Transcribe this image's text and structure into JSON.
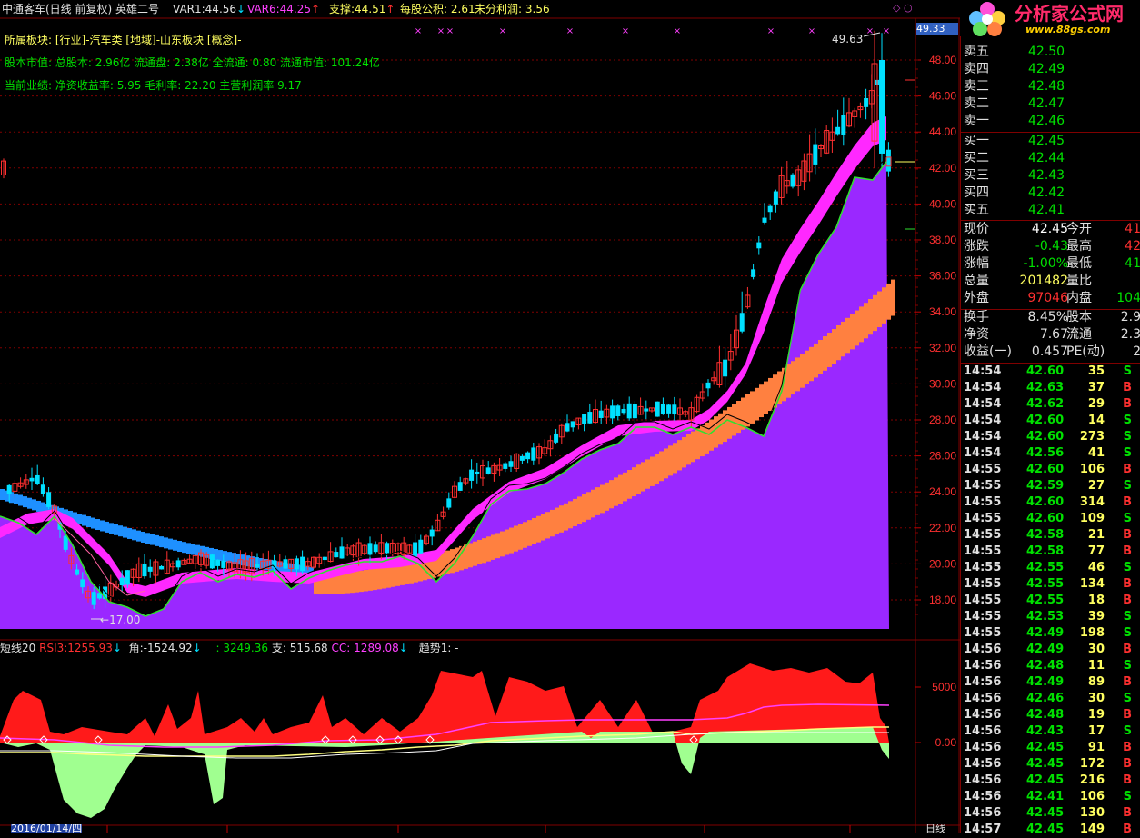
{
  "header": {
    "title": "中通客车(日线 前复权) 英雄二号",
    "var1_label": "VAR1:",
    "var1_value": "44.56",
    "var1_arrow": "↓",
    "var6_label": "VAR6:",
    "var6_value": "44.25",
    "var6_arrow": "↑",
    "support_label": "支撑:",
    "support_value": "44.51",
    "support_arrow": "↑",
    "eps_label": "每股公积:",
    "eps_value": "2.61",
    "undist_label": "未分利润:",
    "undist_value": "3.56"
  },
  "info": {
    "line1": "所属板块: [行业]-汽车类 [地域]-山东板块 [概念]-",
    "line2": "股本市值: 总股本: 2.96亿 流通盘: 2.38亿 全流通: 0.80 流通市值: 101.24亿",
    "line3": "当前业绩: 净资收益率: 5.95 毛利率: 22.20 主营利润率 9.17"
  },
  "chart_labels": {
    "high_marker": "49.63",
    "low_marker": "17.00",
    "current_price_tag": "49.33",
    "date_label": "2016/01/14/四",
    "period_label": "日线"
  },
  "price_axis": [
    "48.00",
    "46.00",
    "44.00",
    "42.00",
    "40.00",
    "38.00",
    "36.00",
    "34.00",
    "32.00",
    "30.00",
    "28.00",
    "26.00",
    "24.00",
    "22.00",
    "20.00",
    "18.00"
  ],
  "indicator": {
    "name": "短线20",
    "rsi_label": "RSI3:",
    "rsi_value": "1255.93",
    "rsi_arrow": "↓",
    "angle_label": "角:",
    "angle_value": "-1524.92",
    "angle_arrow": "↓",
    "v3_value": ": 3249.36",
    "support_label": "支:",
    "support_value": "515.68",
    "cc_label": "CC:",
    "cc_value": "1289.08",
    "cc_arrow": "↓",
    "trend_label": "趋势1: -",
    "axis": [
      "5000",
      "0.00"
    ]
  },
  "order_book": {
    "asks": [
      {
        "label": "卖五",
        "price": "42.50"
      },
      {
        "label": "卖四",
        "price": "42.49"
      },
      {
        "label": "卖三",
        "price": "42.48"
      },
      {
        "label": "卖二",
        "price": "42.47"
      },
      {
        "label": "卖一",
        "price": "42.46"
      }
    ],
    "bids": [
      {
        "label": "买一",
        "price": "42.45"
      },
      {
        "label": "买二",
        "price": "42.44"
      },
      {
        "label": "买三",
        "price": "42.43"
      },
      {
        "label": "买四",
        "price": "42.42"
      },
      {
        "label": "买五",
        "price": "42.41"
      }
    ]
  },
  "quote": {
    "rows": [
      {
        "l1": "现价",
        "v1": "42.45",
        "c1": "#ffffff",
        "l2": "今开",
        "v2": "41",
        "c2": "#ff3030"
      },
      {
        "l1": "涨跌",
        "v1": "-0.43",
        "c1": "#00e000",
        "l2": "最高",
        "v2": "42",
        "c2": "#ff3030"
      },
      {
        "l1": "涨幅",
        "v1": "-1.00%",
        "c1": "#00e000",
        "l2": "最低",
        "v2": "41",
        "c2": "#00e000"
      },
      {
        "l1": "总量",
        "v1": "201482",
        "c1": "#ffff60",
        "l2": "量比",
        "v2": "",
        "c2": "#ffffff"
      },
      {
        "l1": "外盘",
        "v1": "97046",
        "c1": "#ff3030",
        "l2": "内盘",
        "v2": "104",
        "c2": "#00e000"
      }
    ],
    "rows2": [
      {
        "l1": "换手",
        "v1": "8.45%",
        "l2": "股本",
        "v2": "2.9"
      },
      {
        "l1": "净资",
        "v1": "7.67",
        "l2": "流通",
        "v2": "2.3"
      },
      {
        "l1": "收益(一)",
        "v1": "0.457",
        "l2": "PE(动)",
        "v2": "2"
      }
    ]
  },
  "trades": [
    {
      "time": "14:54",
      "price": "42.60",
      "vol": "35",
      "side": "S"
    },
    {
      "time": "14:54",
      "price": "42.63",
      "vol": "37",
      "side": "B"
    },
    {
      "time": "14:54",
      "price": "42.62",
      "vol": "29",
      "side": "B"
    },
    {
      "time": "14:54",
      "price": "42.60",
      "vol": "14",
      "side": "S"
    },
    {
      "time": "14:54",
      "price": "42.60",
      "vol": "273",
      "side": "S"
    },
    {
      "time": "14:54",
      "price": "42.56",
      "vol": "41",
      "side": "S"
    },
    {
      "time": "14:55",
      "price": "42.60",
      "vol": "106",
      "side": "B"
    },
    {
      "time": "14:55",
      "price": "42.59",
      "vol": "27",
      "side": "S"
    },
    {
      "time": "14:55",
      "price": "42.60",
      "vol": "314",
      "side": "B"
    },
    {
      "time": "14:55",
      "price": "42.60",
      "vol": "109",
      "side": "S"
    },
    {
      "time": "14:55",
      "price": "42.58",
      "vol": "21",
      "side": "B"
    },
    {
      "time": "14:55",
      "price": "42.58",
      "vol": "77",
      "side": "B"
    },
    {
      "time": "14:55",
      "price": "42.55",
      "vol": "46",
      "side": "S"
    },
    {
      "time": "14:55",
      "price": "42.55",
      "vol": "134",
      "side": "B"
    },
    {
      "time": "14:55",
      "price": "42.55",
      "vol": "18",
      "side": "B"
    },
    {
      "time": "14:55",
      "price": "42.53",
      "vol": "39",
      "side": "S"
    },
    {
      "time": "14:55",
      "price": "42.49",
      "vol": "198",
      "side": "S"
    },
    {
      "time": "14:56",
      "price": "42.49",
      "vol": "30",
      "side": "B"
    },
    {
      "time": "14:56",
      "price": "42.48",
      "vol": "11",
      "side": "S"
    },
    {
      "time": "14:56",
      "price": "42.49",
      "vol": "89",
      "side": "B"
    },
    {
      "time": "14:56",
      "price": "42.46",
      "vol": "30",
      "side": "S"
    },
    {
      "time": "14:56",
      "price": "42.48",
      "vol": "19",
      "side": "B"
    },
    {
      "time": "14:56",
      "price": "42.43",
      "vol": "17",
      "side": "S"
    },
    {
      "time": "14:56",
      "price": "42.45",
      "vol": "91",
      "side": "B"
    },
    {
      "time": "14:56",
      "price": "42.45",
      "vol": "172",
      "side": "B"
    },
    {
      "time": "14:56",
      "price": "42.45",
      "vol": "216",
      "side": "B"
    },
    {
      "time": "14:56",
      "price": "42.41",
      "vol": "106",
      "side": "S"
    },
    {
      "time": "14:56",
      "price": "42.45",
      "vol": "130",
      "side": "B"
    },
    {
      "time": "14:57",
      "price": "42.45",
      "vol": "149",
      "side": "B"
    }
  ],
  "logo": {
    "text": "分析家公式网",
    "url": "www.88gs.com"
  },
  "colors": {
    "up": "#ff3030",
    "down": "#00e0ff",
    "price_green": "#00e000",
    "fill_purple": "#9a28ff",
    "band_magenta": "#ff28ff",
    "band_blue": "#1e90ff",
    "band_orange": "#ff8040"
  }
}
